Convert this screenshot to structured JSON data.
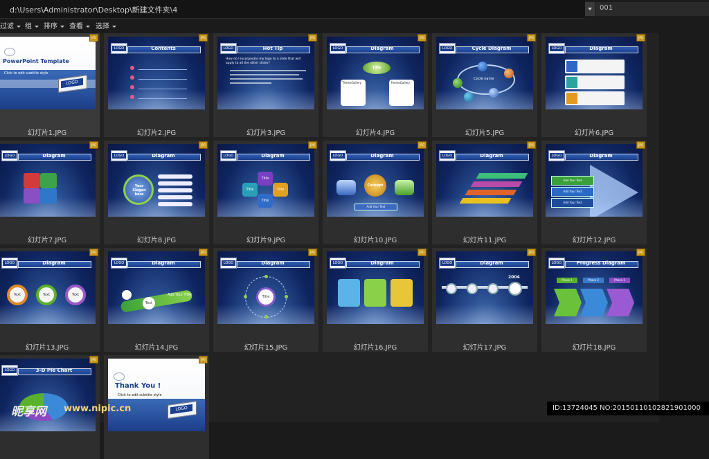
{
  "address": {
    "path": "d:\\Users\\Administrator\\Desktop\\新建文件夹\\4"
  },
  "search": {
    "value": "001"
  },
  "toolbar": {
    "items": [
      "过滤",
      "组",
      "排序",
      "查看",
      "选择"
    ]
  },
  "files": [
    {
      "name": "幻灯片1.JPG",
      "title": "PowerPoint Template"
    },
    {
      "name": "幻灯片2.JPG",
      "title": "Contents"
    },
    {
      "name": "幻灯片3.JPG",
      "title": "Hot Tip"
    },
    {
      "name": "幻灯片4.JPG",
      "title": "Diagram"
    },
    {
      "name": "幻灯片5.JPG",
      "title": "Cycle Diagram"
    },
    {
      "name": "幻灯片6.JPG",
      "title": "Diagram"
    },
    {
      "name": "幻灯片7.JPG",
      "title": "Diagram"
    },
    {
      "name": "幻灯片8.JPG",
      "title": "Diagram"
    },
    {
      "name": "幻灯片9.JPG",
      "title": "Diagram"
    },
    {
      "name": "幻灯片10.JPG",
      "title": "Diagram"
    },
    {
      "name": "幻灯片11.JPG",
      "title": "Diagram"
    },
    {
      "name": "幻灯片12.JPG",
      "title": "Diagram"
    },
    {
      "name": "幻灯片13.JPG",
      "title": "Diagram"
    },
    {
      "name": "幻灯片14.JPG",
      "title": "Diagram"
    },
    {
      "name": "幻灯片15.JPG",
      "title": "Diagram"
    },
    {
      "name": "幻灯片16.JPG",
      "title": "Diagram"
    },
    {
      "name": "幻灯片17.JPG",
      "title": "Diagram"
    },
    {
      "name": "幻灯片18.JPG",
      "title": "Progress Diagram"
    },
    {
      "name": "",
      "title": "3-D Pie Chart"
    },
    {
      "name": "",
      "title": "Thank You !"
    }
  ],
  "slide_text": {
    "subtitle": "Click to edit subtitle style",
    "logo": "LOGO",
    "title_word": "Title",
    "concept": "Concept",
    "cycle_name": "Cycle name",
    "your_slogan": "Your Slogan here",
    "add_your_text": "Add Your Text",
    "add_your_title": "Add Your Title",
    "theme_gallery": "ThemeGallery",
    "text_word": "Text",
    "year_2004": "2004",
    "phase1": "Phase 1",
    "phase2": "Phase 2",
    "phase3": "Phase 3",
    "hot_tip_q": "How do I incorporate my logo to a slide that will apply to all the other slides?"
  },
  "status": {
    "text": "ID:13724045 NO:20150110102821901000"
  },
  "watermark": {
    "brand": "昵享网",
    "url": "www.nipic.cn"
  }
}
